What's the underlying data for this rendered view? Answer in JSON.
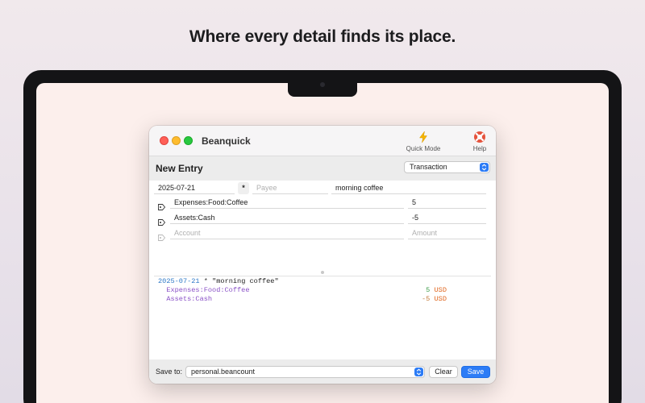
{
  "headline": "Where every detail finds its place.",
  "app": {
    "title": "Beanquick",
    "toolbar": {
      "quick_mode_label": "Quick Mode",
      "help_label": "Help"
    }
  },
  "entry": {
    "section_title": "New Entry",
    "type_select": "Transaction",
    "date": "2025-07-21",
    "flag": "*",
    "payee_placeholder": "Payee",
    "narration": "morning coffee",
    "postings": [
      {
        "account": "Expenses:Food:Coffee",
        "amount": "5"
      },
      {
        "account": "Assets:Cash",
        "amount": "-5"
      }
    ],
    "new_posting": {
      "account_placeholder": "Account",
      "amount_placeholder": "Amount"
    }
  },
  "preview": {
    "date": "2025-07-21",
    "flag": "*",
    "narration": "\"morning coffee\"",
    "lines": [
      {
        "account": "Expenses:Food:Coffee",
        "number": "5",
        "currency": "USD"
      },
      {
        "account": "Assets:Cash",
        "number": "-5",
        "currency": "USD"
      }
    ]
  },
  "footer": {
    "save_to_label": "Save to:",
    "file": "personal.beancount",
    "clear_label": "Clear",
    "save_label": "Save"
  },
  "colors": {
    "accent": "#2c7cf6",
    "preview_date": "#2e79c7",
    "preview_account": "#8a52c7",
    "preview_number": "#3f9d4b",
    "preview_negative": "#c27a3c",
    "preview_currency": "#e0651d"
  },
  "icons": {
    "quick_mode": "lightning-bolt-icon",
    "help": "lifebuoy-icon",
    "posting": "tag-icon",
    "select": "chevron-up-down-icon"
  }
}
